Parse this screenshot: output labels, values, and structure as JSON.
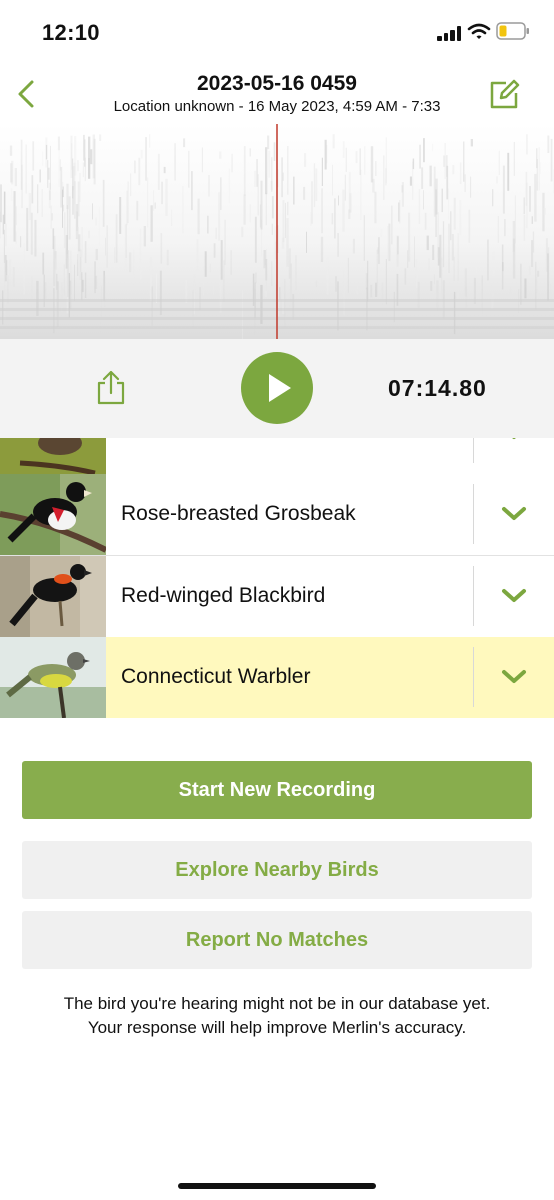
{
  "status_bar": {
    "time": "12:10"
  },
  "header": {
    "title": "2023-05-16 0459",
    "subtitle": "Location unknown - 16 May 2023, 4:59 AM - 7:33"
  },
  "player": {
    "elapsed": "07:14.80"
  },
  "birds": [
    {
      "name": "",
      "thumb_colors": [
        "#6e8a2a",
        "#a0a54a"
      ]
    },
    {
      "name": "Rose-breasted Grosbeak",
      "thumb_colors": [
        "#7c9a55",
        "#d31f2e"
      ]
    },
    {
      "name": "Red-winged Blackbird",
      "thumb_colors": [
        "#b9b09e",
        "#e0501a"
      ]
    },
    {
      "name": "Connecticut Warbler",
      "thumb_colors": [
        "#dfe8e6",
        "#8b9a64"
      ]
    }
  ],
  "buttons": {
    "start": "Start New Recording",
    "explore": "Explore Nearby Birds",
    "report": "Report No Matches"
  },
  "note": {
    "line1": "The bird you're hearing might not be in our database yet.",
    "line2": "Your response will help improve Merlin's accuracy."
  },
  "colors": {
    "accent": "#7ca73f",
    "highlight_row": "#fff9be",
    "playhead": "#c0392b"
  }
}
